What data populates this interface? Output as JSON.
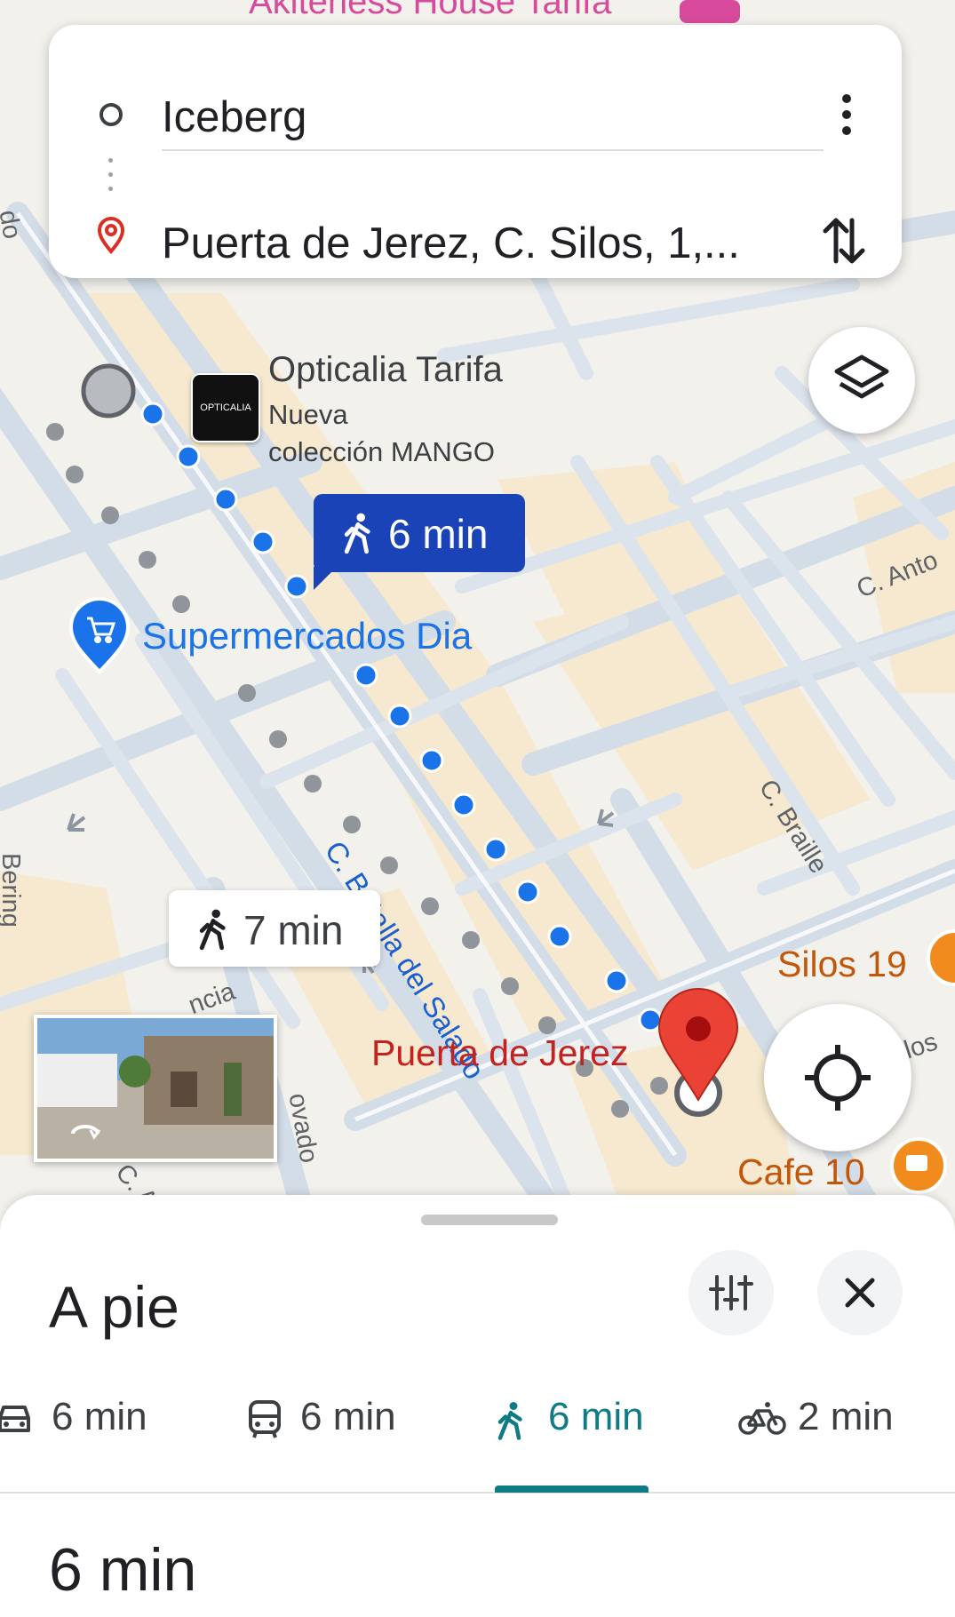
{
  "route": {
    "origin": "Iceberg",
    "destination": "Puerta de Jerez, C. Silos, 1,..."
  },
  "map": {
    "top_label": "Akiteness House Tarifa",
    "poi": {
      "opticalia_title": "Opticalia Tarifa",
      "opticalia_line1": "Nueva",
      "opticalia_line2": "colección MANGO",
      "opticalia_logo": "OPTICALIA",
      "supermarket": "Supermercados Dia",
      "silos": "Silos 19",
      "cafe": "Cafe 10",
      "destination": "Puerta de Jerez"
    },
    "streets": {
      "batalla": "C. Batalla del Salado",
      "braille": "C. Braille",
      "anto": "C. Anto",
      "bering": "Bering",
      "ncia": "ncia",
      "ovado": "ovado",
      "los": "los",
      "ca": "C. A",
      "do": "do"
    },
    "primary_time": "6 min",
    "alt_time": "7 min",
    "colors": {
      "route": "#1a73e8",
      "alt_route": "#9aa0a6",
      "callout": "#1a43b8",
      "destination_pin": "#ea4335",
      "accent_tab": "#0f7c85"
    }
  },
  "sheet": {
    "title": "A pie",
    "modes": [
      {
        "icon": "car-icon",
        "label": "6 min"
      },
      {
        "icon": "transit-icon",
        "label": "6 min"
      },
      {
        "icon": "walk-icon",
        "label": "6 min",
        "active": true
      },
      {
        "icon": "bike-icon",
        "label": "2 min"
      }
    ],
    "summary": "6 min"
  }
}
